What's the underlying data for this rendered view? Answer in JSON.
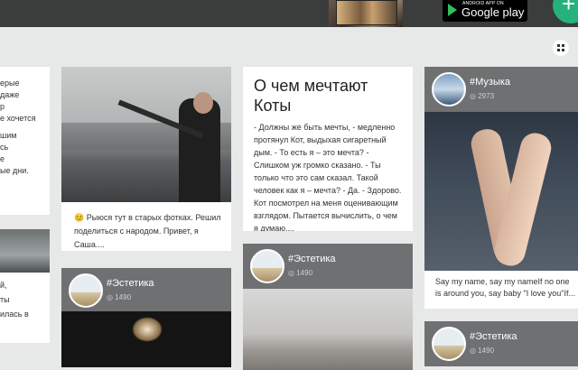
{
  "topbar": {
    "store_small": "ANDROID APP ON",
    "store_big": "Google play",
    "fab": "+"
  },
  "left_card": {
    "lines": [
      "ерые",
      "даже",
      "р",
      "е хочется",
      "шим",
      "сь",
      "е",
      "ые дни."
    ]
  },
  "left_card2": {
    "lines": [
      "й,",
      "ты",
      "илась в"
    ]
  },
  "card_guitar": {
    "text": "😊 Рыюся тут в старых фотках. Решил поделиться с народом. Привет, я Саша...."
  },
  "card_esthetics_1": {
    "tag": "#Эстетика",
    "count": "1490"
  },
  "card_cats": {
    "title": "О чем мечтают Коты",
    "text": "- Должны же быть мечты, - медленно протянул Кот, выдыхая сигаретный дым. - То есть я – это мечта? - Слишком уж громко сказано. - Ты только что это сам сказал. Такой человек как я – мечта? - Да. - Здорово. Кот посмотрел на меня оценивающим взглядом. Пытается вычислить, о чем я думаю...."
  },
  "card_esthetics_2": {
    "tag": "#Эстетика",
    "count": "1490"
  },
  "card_music": {
    "tag": "#Музыка",
    "count": "2973",
    "text": "Say my name, say my nameIf no one is around you, say baby \"I love you\"If..."
  },
  "card_esthetics_3": {
    "tag": "#Эстетика",
    "count": "1490"
  }
}
